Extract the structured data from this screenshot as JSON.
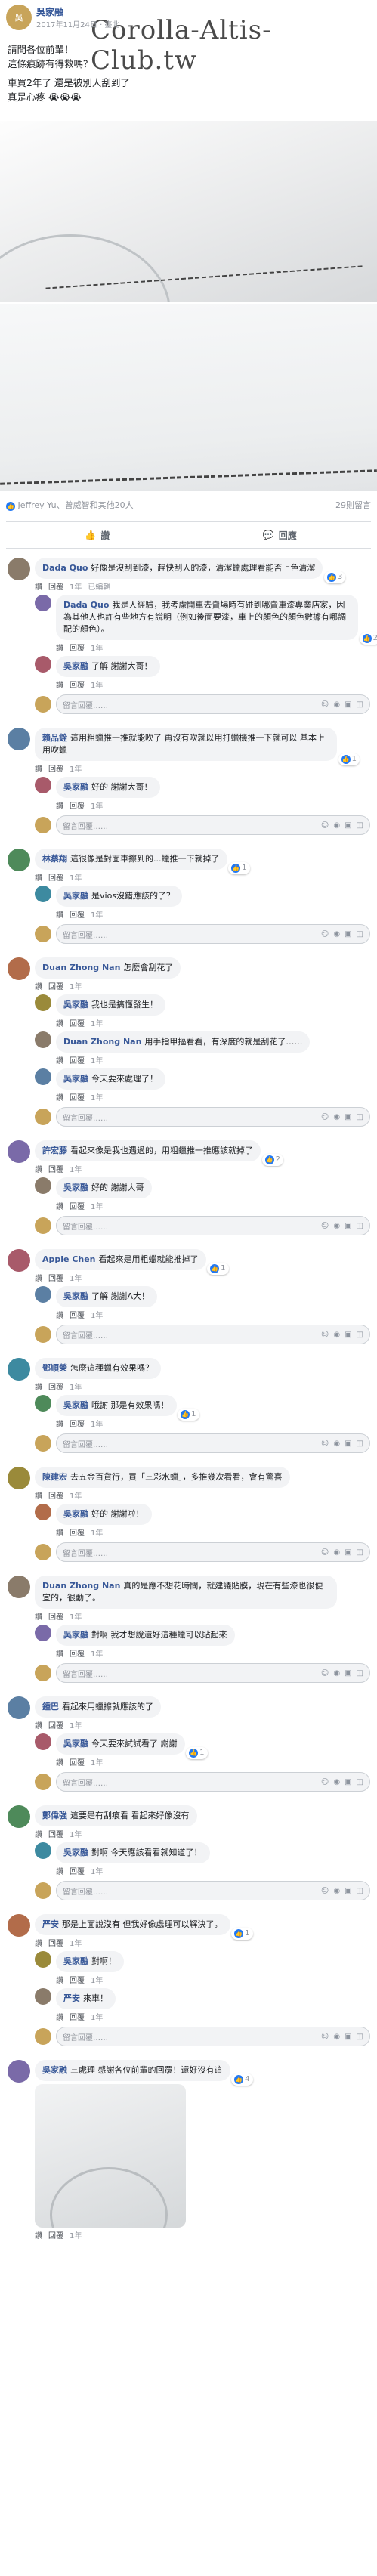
{
  "watermark": "Corolla-Altis-Club.tw",
  "post": {
    "author": "吳家融",
    "time": "2017年11月24日 · 臺北",
    "lines": [
      "請問各位前輩！",
      "這條痕跡有得救嗎？",
      "",
      "車買2年了 還是被別人刮到了",
      "真是心疼 😭😭😭"
    ],
    "reactions": "Jeffrey Yu、曾威智和其他20人",
    "comments_count": "29則留言",
    "like_label": "讚",
    "reply_label": "回應"
  },
  "write_placeholder": "留言回覆……",
  "actions": {
    "like": "讚",
    "reply": "回覆",
    "time": "1年"
  },
  "threads": [
    {
      "name": "Dada Quo",
      "text": "好像是沒刮到漆，趕快刮人的漆，清潔蠟處理看能否上色清潔",
      "likes": "3",
      "extra": "已編輯",
      "replies": [
        {
          "name": "Dada Quo",
          "text": "我是人經驗，我考慮開車去賣場時有碰到哪賣車漆專業店家，因為其他人也許有些地方有說明（例如後面要漆，車上的顏色的顏色數據有哪調配的顏色）。",
          "likes": "2"
        },
        {
          "name": "吳家融",
          "text": "了解 謝謝大哥！",
          "likes": ""
        }
      ]
    },
    {
      "name": "賴品銓",
      "text": "這用粗蠟推一推就能吹了 再沒有吹就以用打蠟機推一下就可以 基本上用吹蠟",
      "likes": "1",
      "replies": [
        {
          "name": "吳家融",
          "text": "好的 謝謝大哥！",
          "likes": ""
        }
      ]
    },
    {
      "name": "林蔡翔",
      "text": "這很像是對面車擦到的...蠟推一下就掉了",
      "likes": "1",
      "replies": [
        {
          "name": "吳家融",
          "text": "是vios沒錯應該的了？",
          "likes": ""
        }
      ]
    },
    {
      "name": "Duan Zhong Nan",
      "text": "怎麼會刮花了",
      "likes": "",
      "replies": [
        {
          "name": "吳家融",
          "text": "我也是搞懂發生！",
          "likes": ""
        },
        {
          "name": "Duan Zhong Nan",
          "text": "用手指甲摳看看，有深度的就是刮花了……",
          "likes": ""
        },
        {
          "name": "吳家融",
          "text": "今天要來處理了！",
          "likes": ""
        }
      ]
    },
    {
      "name": "許宏藤",
      "text": "看起來像是我也遇過的，用粗蠟推一推應該就掉了",
      "likes": "2",
      "replies": [
        {
          "name": "吳家融",
          "text": "好的 謝謝大哥",
          "likes": ""
        }
      ]
    },
    {
      "name": "Apple Chen",
      "text": "看起來是用粗蠟就能推掉了",
      "likes": "1",
      "replies": [
        {
          "name": "吳家融",
          "text": "了解 謝謝A大！",
          "likes": ""
        }
      ]
    },
    {
      "name": "鄧順榮",
      "text": "怎麼這種蠟有效果嗎？",
      "likes": "",
      "replies": [
        {
          "name": "吳家融",
          "text": "哦謝 那是有效果嗎！",
          "likes": "1"
        }
      ]
    },
    {
      "name": "陳建宏",
      "text": "去五金百貨行，買「三彩水蠟」，多推幾次看看，會有驚喜",
      "likes": "",
      "replies": [
        {
          "name": "吳家融",
          "text": "好的 謝謝啦！",
          "likes": ""
        }
      ]
    },
    {
      "name": "Duan Zhong Nan",
      "text": "真的是應不想花時間，就建議貼膜，現在有些漆也很便宜的，很動了。",
      "likes": "",
      "replies": [
        {
          "name": "吳家融",
          "text": "對啊 我才想說還好這種蠟可以貼起來",
          "likes": ""
        }
      ]
    },
    {
      "name": "鍾巴",
      "text": "看起來用蠟擦就應該的了",
      "likes": "",
      "replies": [
        {
          "name": "吳家融",
          "text": "今天要來試試看了 謝謝",
          "likes": "1"
        }
      ]
    },
    {
      "name": "鄭偉強",
      "text": "這要是有刮痕看 看起來好像沒有",
      "likes": "",
      "replies": [
        {
          "name": "吳家融",
          "text": "對啊 今天應該看看就知道了！",
          "likes": ""
        }
      ]
    },
    {
      "name": "严安",
      "text": "那是上面說沒有 但我好像處理可以解決了。",
      "likes": "1",
      "replies": [
        {
          "name": "吳家融",
          "text": "對啊！",
          "likes": ""
        },
        {
          "name": "严安",
          "text": "來車！",
          "likes": ""
        }
      ]
    },
    {
      "name": "吳家融",
      "text": "三處理 感謝各位前輩的回覆！還好沒有這",
      "likes": "4",
      "replies": [],
      "photo": true
    }
  ],
  "colors": {
    "link": "#385898",
    "like": "#2078f4",
    "bubble": "#f2f3f5"
  }
}
